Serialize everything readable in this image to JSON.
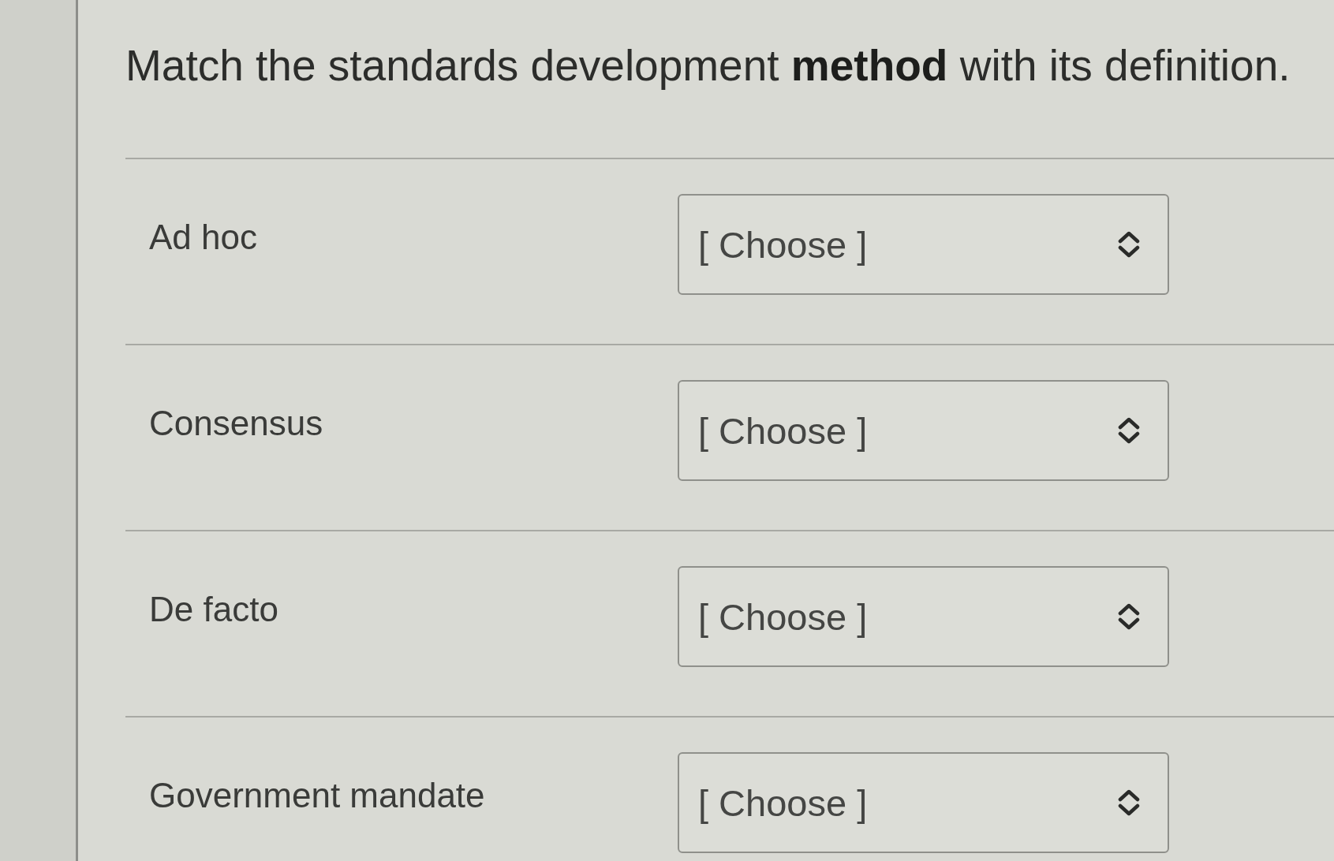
{
  "question": {
    "title": "Match the standards development **method** with its definition."
  },
  "rows": [
    {
      "label": "Ad hoc",
      "select": {
        "value": "[ Choose ]"
      }
    },
    {
      "label": "Consensus",
      "select": {
        "value": "[ Choose ]"
      }
    },
    {
      "label": "De facto",
      "select": {
        "value": "[ Choose ]"
      }
    },
    {
      "label": "Government mandate",
      "select": {
        "value": "[ Choose ]"
      }
    }
  ]
}
